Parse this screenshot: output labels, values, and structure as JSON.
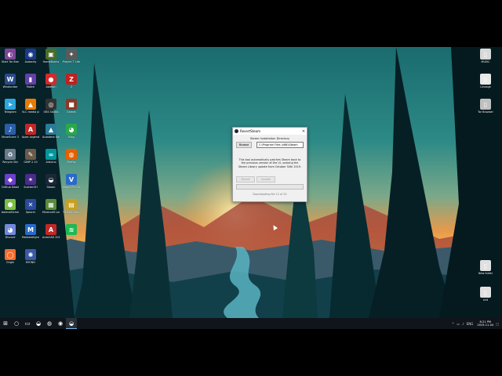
{
  "desktop_icons_left": [
    {
      "label": "Start Tor Browser",
      "icon": "tor-icon",
      "color": "#7d4698",
      "glyph": "◐"
    },
    {
      "label": "Audacity",
      "icon": "audacity-icon",
      "color": "#1a3a8a",
      "glyph": "◉"
    },
    {
      "label": "HomeBrains",
      "icon": "homebrains-icon",
      "color": "#4a6b2a",
      "glyph": "▣"
    },
    {
      "label": "Project T Lite",
      "icon": "project-icon",
      "color": "#5a5a5a",
      "glyph": "✦"
    },
    {
      "label": "Windscribe",
      "icon": "windscribe-icon",
      "color": "#2a4a8a",
      "glyph": "W"
    },
    {
      "label": "Twitch",
      "icon": "twitch-icon",
      "color": "#6441a5",
      "glyph": "▮"
    },
    {
      "label": "Ableton",
      "icon": "ableton-icon",
      "color": "#d42a2a",
      "glyph": "●"
    },
    {
      "label": "Z",
      "icon": "z-icon",
      "color": "#c02020",
      "glyph": "Z"
    },
    {
      "label": "Telegram",
      "icon": "telegram-icon",
      "color": "#2ca5e0",
      "glyph": "➤"
    },
    {
      "label": "VLC media player",
      "icon": "vlc-icon",
      "color": "#e87b00",
      "glyph": "▲"
    },
    {
      "label": "OBS Studio",
      "icon": "obs-icon",
      "color": "#333333",
      "glyph": "◎"
    },
    {
      "label": "Games",
      "icon": "games-icon",
      "color": "#8a3a2a",
      "glyph": "■"
    },
    {
      "label": "MuseScore 3",
      "icon": "musescore-icon",
      "color": "#2a5ea8",
      "glyph": "♪"
    },
    {
      "label": "Apex Legends",
      "icon": "apex-icon",
      "color": "#c02828",
      "glyph": "A"
    },
    {
      "label": "Autodesk Desktop",
      "icon": "autodesk-icon",
      "color": "#2a7a9a",
      "glyph": "▲"
    },
    {
      "label": "Blog",
      "icon": "blog-icon",
      "color": "#2aa84a",
      "glyph": "◕"
    },
    {
      "label": "Recycle Bin",
      "icon": "recycle-bin-icon",
      "color": "#6a7a8a",
      "glyph": "♻"
    },
    {
      "label": "GIMP 2.10",
      "icon": "gimp-icon",
      "color": "#6a5a4a",
      "glyph": "✎"
    },
    {
      "label": "Arduino",
      "icon": "arduino-icon",
      "color": "#00979c",
      "glyph": "∞"
    },
    {
      "label": "Firefox",
      "icon": "firefox-icon",
      "color": "#e66000",
      "glyph": "◍"
    },
    {
      "label": "GitHub Desktop",
      "icon": "github-icon",
      "color": "#6e40c9",
      "glyph": "◆"
    },
    {
      "label": "ScatterOH",
      "icon": "scatter-icon",
      "color": "#4a2a8a",
      "glyph": "✶"
    },
    {
      "label": "Steam",
      "icon": "steam-icon",
      "color": "#1b2838",
      "glyph": "◒"
    },
    {
      "label": "Vegas Pro 16.0",
      "icon": "vegas-icon",
      "color": "#2a6ac8",
      "glyph": "V"
    },
    {
      "label": "balenaEtcher",
      "icon": "etcher-icon",
      "color": "#7ac142",
      "glyph": "⬢"
    },
    {
      "label": "Xplorer",
      "icon": "xplorer-icon",
      "color": "#2a4a9a",
      "glyph": "✕"
    },
    {
      "label": "Minecraft Launcher",
      "icon": "minecraft-icon",
      "color": "#5a8a3a",
      "glyph": "▦"
    },
    {
      "label": "TikiEdit Demo",
      "icon": "tikiedit-icon",
      "color": "#c8a020",
      "glyph": "▤"
    },
    {
      "label": "Discord",
      "icon": "discord-icon",
      "color": "#7289da",
      "glyph": "◕"
    },
    {
      "label": "Malwarebytes",
      "icon": "malwarebytes-icon",
      "color": "#2a6ac8",
      "glyph": "M"
    },
    {
      "label": "AutoCAD 2019",
      "icon": "autocad-icon",
      "color": "#c02828",
      "glyph": "A"
    },
    {
      "label": "Spotify",
      "icon": "spotify-icon",
      "color": "#1db954",
      "glyph": "≋"
    },
    {
      "label": "Origin",
      "icon": "origin-icon",
      "color": "#f56c2d",
      "glyph": "◯"
    },
    {
      "label": "BYOND",
      "icon": "byond-icon",
      "color": "#3a5aa8",
      "glyph": "✺"
    }
  ],
  "desktop_icons_right": [
    {
      "label": "MUSIC",
      "icon": "music-folder-icon",
      "color": "#d9d9d9",
      "glyph": "▯"
    },
    {
      "label": "Lineage",
      "icon": "lineage-file-icon",
      "color": "#e8e8e8",
      "glyph": "▯"
    },
    {
      "label": "Tor Browser",
      "icon": "tor-browser-icon",
      "color": "#c0c0c0",
      "glyph": "▯"
    },
    {
      "label": "New folder",
      "icon": "new-folder-icon",
      "color": "#e0e0e0",
      "glyph": "▯"
    },
    {
      "label": "shit",
      "icon": "shit-file-icon",
      "color": "#e0e0e0",
      "glyph": "▯"
    }
  ],
  "dialog": {
    "title": "RevertSteam",
    "section_label": "Steam Installation Directory",
    "browse_label": "Browse",
    "path_value": "C:\\Program Files (x86)\\Steam",
    "description": "This tool automatically patches Steam back to the previous version of the UI, undoing the Steam Library update from October 30th 2019.",
    "button_left": "Revert",
    "button_right": "Update",
    "progress_fraction": 0.0,
    "progress_color": "#06b025",
    "status": "Downloading file 12 of 22"
  },
  "taskbar": {
    "start_glyph": "⊞",
    "items": [
      {
        "name": "search-icon",
        "glyph": "○"
      },
      {
        "name": "file-explorer-icon",
        "glyph": "▭"
      },
      {
        "name": "steam-taskbar-icon",
        "glyph": "◒"
      },
      {
        "name": "firefox-taskbar-icon",
        "glyph": "◍"
      },
      {
        "name": "chrome-taskbar-icon",
        "glyph": "◉"
      },
      {
        "name": "revertsteam-taskbar-icon",
        "glyph": "◒"
      }
    ],
    "language": "ENG",
    "time": "8:21 PM",
    "date": "2019-11-04"
  }
}
